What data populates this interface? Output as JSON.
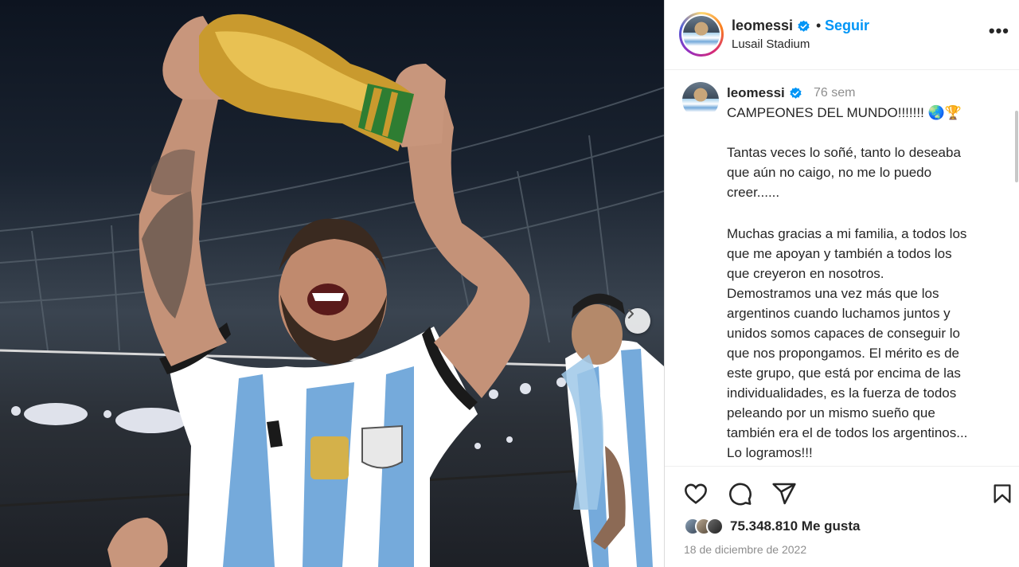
{
  "header": {
    "username": "leomessi",
    "dot": "•",
    "follow_label": "Seguir",
    "location": "Lusail Stadium",
    "more_label": "•••"
  },
  "caption": {
    "username": "leomessi",
    "time": "76 sem",
    "title": "CAMPEONES DEL MUNDO!!!!!!! 🌏🏆",
    "paragraph1": "Tantas veces lo soñé, tanto lo deseaba\nque aún no caigo, no me lo puedo\ncreer......",
    "paragraph2": "Muchas gracias a mi familia, a todos los\nque me apoyan y también a todos los\nque creyeron en nosotros.\nDemostramos una vez más que los\nargentinos cuando luchamos juntos y\nunidos somos capaces de conseguir lo\nque nos propongamos. El mérito es de\neste grupo, que está por encima de las\nindividualidades, es la fuerza de todos\npeleando por un mismo sueño que\ntambién era el de todos los argentinos...\nLo logramos!!!"
  },
  "footer": {
    "likes": "75.348.810 Me gusta",
    "date": "18 de diciembre de 2022"
  },
  "icons": {
    "verified": "verified-badge-icon",
    "like": "heart-icon",
    "comment": "comment-icon",
    "share": "share-icon",
    "save": "bookmark-icon",
    "next": "chevron-right-icon"
  },
  "colors": {
    "accent": "#0095f6",
    "verified": "#0095f6",
    "muted": "#8e8e8e",
    "text": "#262626"
  }
}
